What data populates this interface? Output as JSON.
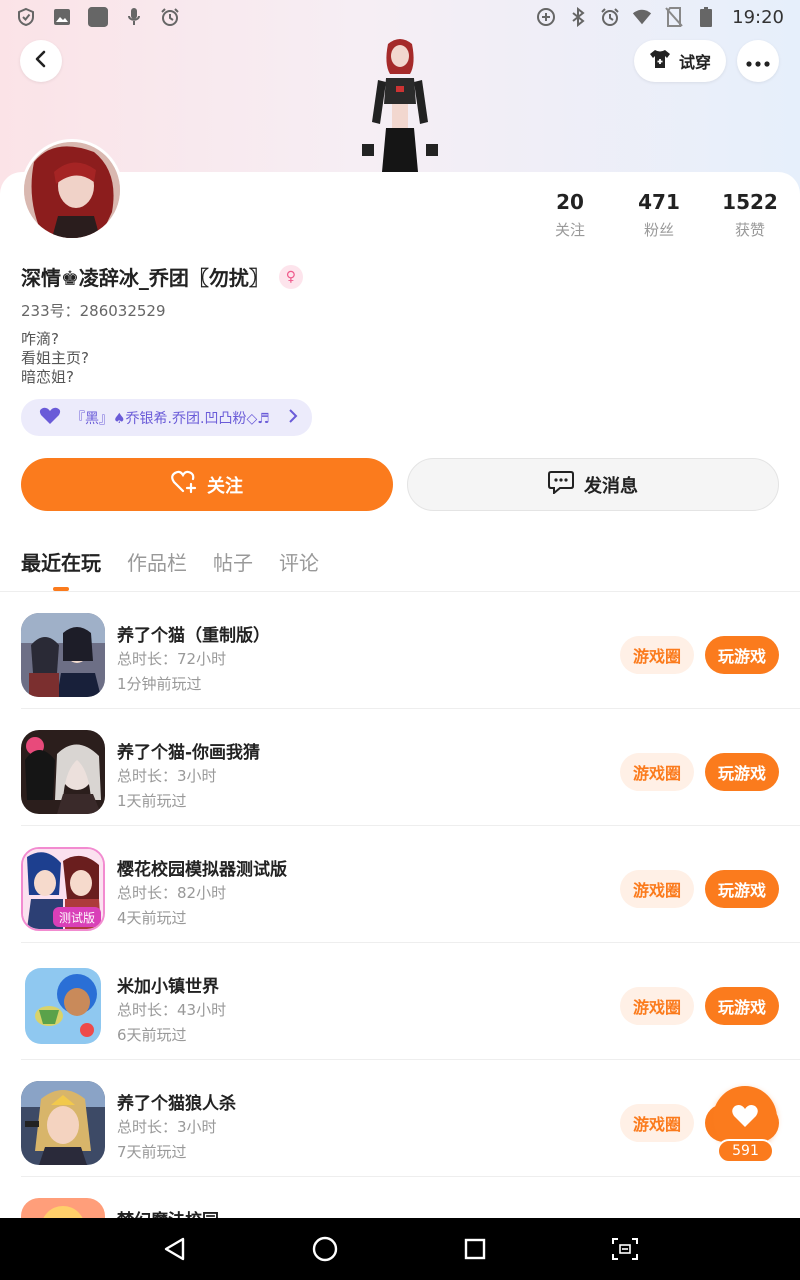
{
  "status_bar": {
    "time": "19:20",
    "left_icons": [
      "shield-check-icon",
      "image-icon",
      "app-square-icon",
      "mic-icon",
      "alarm-icon"
    ],
    "right_icons": [
      "data-saver-icon",
      "bluetooth-icon",
      "alarm-icon",
      "wifi-icon",
      "no-sim-icon",
      "battery-icon"
    ]
  },
  "header": {
    "back_icon": "chevron-left-icon",
    "try_on_label": "试穿",
    "more_icon": "more-dots-icon"
  },
  "profile": {
    "name": "深情♚凌辞冰_乔团〖勿扰〗",
    "gender_symbol": "♀",
    "id_text": "233号：286032529",
    "bio": [
      "咋滴?",
      "看姐主页?",
      "暗恋姐?"
    ],
    "club": "『黑』♠乔银希.乔团.凹凸粉◇♬",
    "stats": [
      {
        "num": "20",
        "label": "关注"
      },
      {
        "num": "471",
        "label": "粉丝"
      },
      {
        "num": "1522",
        "label": "获赞"
      }
    ]
  },
  "actions": {
    "follow_label": "关注",
    "message_label": "发消息"
  },
  "tabs": [
    "最近在玩",
    "作品栏",
    "帖子",
    "评论"
  ],
  "games": [
    {
      "title": "养了个猫（重制版）",
      "duration": "总时长：72小时",
      "last": "1分钟前玩过"
    },
    {
      "title": "养了个猫-你画我猜",
      "duration": "总时长：3小时",
      "last": "1天前玩过"
    },
    {
      "title": "樱花校园模拟器测试版",
      "duration": "总时长：82小时",
      "last": "4天前玩过"
    },
    {
      "title": "米加小镇世界",
      "duration": "总时长：43小时",
      "last": "6天前玩过"
    },
    {
      "title": "养了个猫狼人杀",
      "duration": "总时长：3小时",
      "last": "7天前玩过"
    },
    {
      "title": "梦幻魔法校园",
      "duration": "",
      "last": ""
    }
  ],
  "game_buttons": {
    "circle": "游戏圈",
    "play": "玩游戏"
  },
  "test_badge": "测试版",
  "float_like": {
    "count": "591"
  },
  "colors": {
    "accent": "#fb7b1d",
    "club_text": "#6a5bd8"
  }
}
